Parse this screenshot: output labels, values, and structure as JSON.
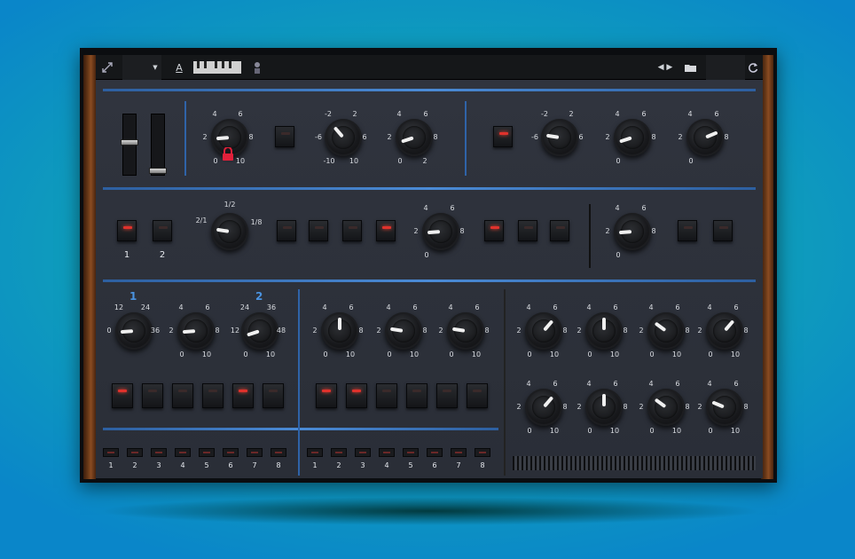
{
  "toolbar": {
    "expand_icon": "expand-icon",
    "preset_menu": "",
    "page_a_label": "A",
    "prev_next_icon": "prev-next-arrows-icon",
    "folder_icon": "folder-icon",
    "sync_icon": "sync-icon"
  },
  "row1": {
    "knob_a": {
      "labels": [
        "4",
        "6",
        "2",
        "8",
        "0",
        "10"
      ],
      "level": 0.15
    },
    "knob_b": {
      "labels": [
        "-2",
        "2",
        "-6",
        "6",
        "-10",
        "10"
      ],
      "level": 0.35
    },
    "knob_c": {
      "labels": [
        "4",
        "6",
        "2",
        "8",
        "0",
        "2"
      ],
      "level": 0.1
    },
    "knob_d": {
      "labels": [
        "-2",
        "2",
        "-6",
        "6"
      ],
      "level": 0.2
    },
    "knob_e": {
      "labels": [
        "4",
        "6",
        "2",
        "8",
        "0"
      ],
      "level": 0.1
    },
    "knob_f": {
      "labels": [
        "4",
        "6",
        "2",
        "8",
        "0"
      ],
      "level": 0.75
    }
  },
  "row2": {
    "btn_1_label": "1",
    "btn_2_label": "2",
    "div_knob": {
      "labels": [
        "1/2",
        "2/1",
        "1/8"
      ],
      "level": 0.2
    },
    "knob_g": {
      "labels": [
        "4",
        "6",
        "2",
        "8",
        "0"
      ],
      "level": 0.15
    },
    "knob_h": {
      "labels": [
        "4",
        "6",
        "2",
        "8",
        "0"
      ],
      "level": 0.15
    }
  },
  "section3": {
    "header_1": "1",
    "header_2": "2",
    "knob_r1": [
      {
        "labels": [
          "12",
          "24",
          "0",
          "36"
        ],
        "level": 0.15
      },
      {
        "labels": [
          "4",
          "6",
          "2",
          "8",
          "0",
          "10"
        ],
        "level": 0.15
      },
      {
        "labels": [
          "24",
          "36",
          "12",
          "48",
          "0",
          "10"
        ],
        "level": 0.1
      },
      {
        "labels": [
          "4",
          "6",
          "2",
          "8",
          "0",
          "10"
        ],
        "level": 0.5
      },
      {
        "labels": [
          "4",
          "6",
          "2",
          "8",
          "0",
          "10"
        ],
        "level": 0.2
      },
      {
        "labels": [
          "4",
          "6",
          "2",
          "8",
          "0",
          "10"
        ],
        "level": 0.2
      },
      {
        "labels": [
          "4",
          "6",
          "2",
          "8",
          "0",
          "10"
        ],
        "level": 0.65
      },
      {
        "labels": [
          "4",
          "6",
          "2",
          "8",
          "0",
          "10"
        ],
        "level": 0.5
      },
      {
        "labels": [
          "4",
          "6",
          "2",
          "8",
          "0",
          "10"
        ],
        "level": 0.3
      },
      {
        "labels": [
          "4",
          "6",
          "2",
          "8",
          "0",
          "10"
        ],
        "level": 0.65
      }
    ],
    "knob_r2": [
      {
        "labels": [
          "4",
          "6",
          "2",
          "8",
          "0",
          "10"
        ],
        "level": 0.65
      },
      {
        "labels": [
          "4",
          "6",
          "2",
          "8",
          "0",
          "10"
        ],
        "level": 0.5
      },
      {
        "labels": [
          "4",
          "6",
          "2",
          "8",
          "0",
          "10"
        ],
        "level": 0.3
      },
      {
        "labels": [
          "4",
          "6",
          "2",
          "8",
          "0",
          "10"
        ],
        "level": 0.25
      }
    ]
  },
  "step_labels_a": [
    "1",
    "2",
    "3",
    "4",
    "5",
    "6",
    "7",
    "8"
  ],
  "step_labels_b": [
    "1",
    "2",
    "3",
    "4",
    "5",
    "6",
    "7",
    "8"
  ]
}
